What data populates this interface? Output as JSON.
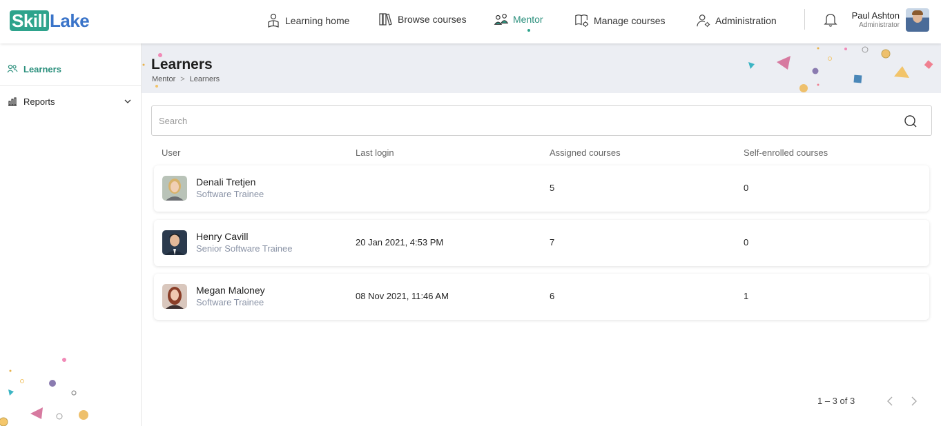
{
  "brand": {
    "part1": "Skill",
    "part2": "Lake"
  },
  "nav": {
    "items": [
      {
        "label": "Learning home",
        "icon": "learner-icon"
      },
      {
        "label": "Browse courses",
        "icon": "books-icon"
      },
      {
        "label": "Mentor",
        "icon": "mentor-icon",
        "active": true
      },
      {
        "label": "Manage courses",
        "icon": "manage-courses-icon"
      },
      {
        "label": "Administration",
        "icon": "admin-user-gear-icon"
      }
    ]
  },
  "user": {
    "name": "Paul Ashton",
    "role": "Administrator"
  },
  "sidebar": {
    "items": [
      {
        "label": "Learners",
        "icon": "users-icon",
        "active": true
      },
      {
        "label": "Reports",
        "icon": "bar-chart-icon"
      }
    ]
  },
  "page": {
    "title": "Learners",
    "breadcrumb": {
      "parent": "Mentor",
      "sep": ">",
      "current": "Learners"
    }
  },
  "search": {
    "placeholder": "Search"
  },
  "table": {
    "columns": [
      "User",
      "Last login",
      "Assigned courses",
      "Self-enrolled courses"
    ],
    "rows": [
      {
        "name": "Denali Tretjen",
        "title": "Software Trainee",
        "last_login": "",
        "assigned": "5",
        "self_enrolled": "0"
      },
      {
        "name": "Henry Cavill",
        "title": "Senior Software Trainee",
        "last_login": "20 Jan 2021, 4:53 PM",
        "assigned": "7",
        "self_enrolled": "0"
      },
      {
        "name": "Megan Maloney",
        "title": "Software Trainee",
        "last_login": "08 Nov 2021, 11:46 AM",
        "assigned": "6",
        "self_enrolled": "1"
      }
    ]
  },
  "pagination": {
    "label": "1 – 3 of 3"
  },
  "colors": {
    "accent": "#2ea38c",
    "brand_blue": "#3a74c9",
    "banner": "#eceef3"
  }
}
